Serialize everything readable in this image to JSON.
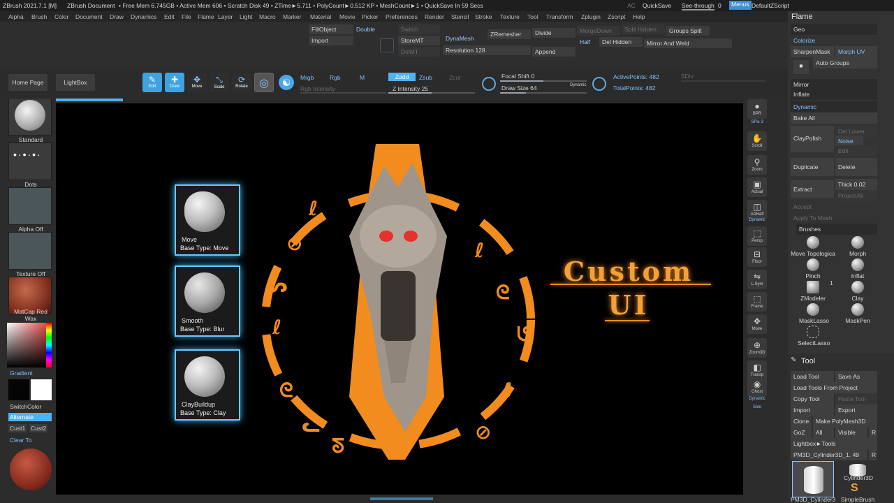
{
  "titlebar": {
    "app": "ZBrush 2021.7.1 [M]",
    "doc": "ZBrush Document",
    "stats": "• Free Mem 6.745GB • Active Mem 606 • Scratch Disk 49 • ZTime►5.711 • PolyCount►0.512 KP • MeshCount►1 • QuickSave In 59 Secs",
    "ac": "AC",
    "quicksave": "QuickSave",
    "seethrough": "See-through",
    "seethrough_val": "0",
    "menus": "Menus",
    "script": "DefaultZScript"
  },
  "menu": [
    "Alpha",
    "Brush",
    "Color",
    "Document",
    "Draw",
    "Dynamics",
    "Edit",
    "File",
    "Flame",
    "Layer",
    "Light",
    "Macro",
    "Marker",
    "Material",
    "Movie",
    "Picker",
    "Preferences",
    "Render",
    "Stencil",
    "Stroke",
    "Texture",
    "Tool",
    "Transform",
    "Zplugin",
    "Zscript",
    "Help"
  ],
  "topshelf": {
    "fillobject": "FillObject",
    "double": "Double",
    "import": "Import",
    "switch": "Switch",
    "storemt": "StoreMT",
    "delmt": "DelMT",
    "dynamesh": "DynaMesh",
    "resolution": "Resolution 128",
    "zremesher": "ZRemesher",
    "divide": "Divide",
    "append": "Append",
    "mergedown": "MergeDown",
    "splithidden": "Split Hidden",
    "groupssplit": "Groups Split",
    "half": "Half",
    "delhidden": "Del Hidden",
    "mirrorweld": "Mirror And Weld"
  },
  "toolbar": {
    "home": "Home Page",
    "lightbox": "LightBox",
    "edit": "Edit",
    "draw": "Draw",
    "move": "Move",
    "scale": "Scale",
    "rotate": "Rotate",
    "mrgb": "Mrgb",
    "rgb": "Rgb",
    "m": "M",
    "rgbint": "Rgb Intensity",
    "zadd": "Zadd",
    "zsub": "Zsub",
    "zcut": "Zcut",
    "zint": "Z Intensity 25",
    "focal": "Focal Shift 0",
    "drawsize": "Draw Size 64",
    "dynamic": "Dynamic",
    "activepts": "ActivePoints: 482",
    "totalpts": "TotalPoints: 482",
    "sdiv": "SDiv"
  },
  "leftshelf": {
    "standard": "Standard",
    "dots": "Dots",
    "alpha": "Alpha Off",
    "texture": "Texture Off",
    "matcap": "MatCap Red Wax",
    "gradient": "Gradient",
    "switchcolor": "SwitchColor",
    "alternate": "Alternate",
    "cust1": "Cust1",
    "cust2": "Cust2",
    "clearto": "Clear To"
  },
  "brushes": [
    {
      "name": "Move",
      "base": "Base Type: Move"
    },
    {
      "name": "Smooth",
      "base": "Base Type: Blur"
    },
    {
      "name": "ClayBuildup",
      "base": "Base Type: Clay"
    }
  ],
  "canvas": {
    "line1": "Custom",
    "line2": "UI"
  },
  "rightshelf": [
    "BPR",
    "SPix 3",
    "Scroll",
    "Zoom",
    "Actual",
    "AAHalf",
    "Dynamic",
    "Persp",
    "Floor",
    "L.Sym",
    "Frame",
    "Move",
    "Zoom3D",
    "Transp",
    "Ghost",
    "Dynamic",
    "Solo"
  ],
  "flame": {
    "title": "Flame",
    "geo": "Geo",
    "colorize": "Colorize",
    "sharpenmask": "SharpenMask",
    "morphuv": "Morph UV",
    "autogroups": "Auto Groups",
    "mirror": "Mirror",
    "inflate": "Inflate",
    "dynamic": "Dynamic",
    "bakeall": "Bake All",
    "claypolish": "ClayPolish",
    "dellower": "Del Lower",
    "noise": "Noise",
    "edit": "Edit",
    "duplicate": "Duplicate",
    "delete": "Delete",
    "extract": "Extract",
    "thick": "Thick 0.02",
    "projectall": "ProjectAll",
    "accept": "Accept",
    "applymesh": "Apply To Mesh",
    "brushes": "Brushes",
    "b1": "Move Topologica",
    "b2": "Morph",
    "b3": "Pinch",
    "b4": "Inflat",
    "b5": "ZModeler",
    "b5n": "1",
    "b6": "Clay",
    "b7": "MaskLasso",
    "b8": "MaskPen",
    "b9": "SelectLasso"
  },
  "tool": {
    "title": "Tool",
    "load": "Load Tool",
    "save": "Save As",
    "loadproj": "Load Tools From Project",
    "copy": "Copy Tool",
    "paste": "Paste Tool",
    "import": "Import",
    "export": "Export",
    "clone": "Clone",
    "makepoly": "Make PolyMesh3D",
    "goz": "GoZ",
    "all": "All",
    "visible": "Visible",
    "r": "R",
    "lbtools": "Lightbox►Tools",
    "current": "PM3D_Cylinder3D_1. 49",
    "r2": "R",
    "cyl": "Cylinder3D",
    "cylthumb": "PM3D_Cylinder3",
    "simple": "SimpleBrush"
  }
}
